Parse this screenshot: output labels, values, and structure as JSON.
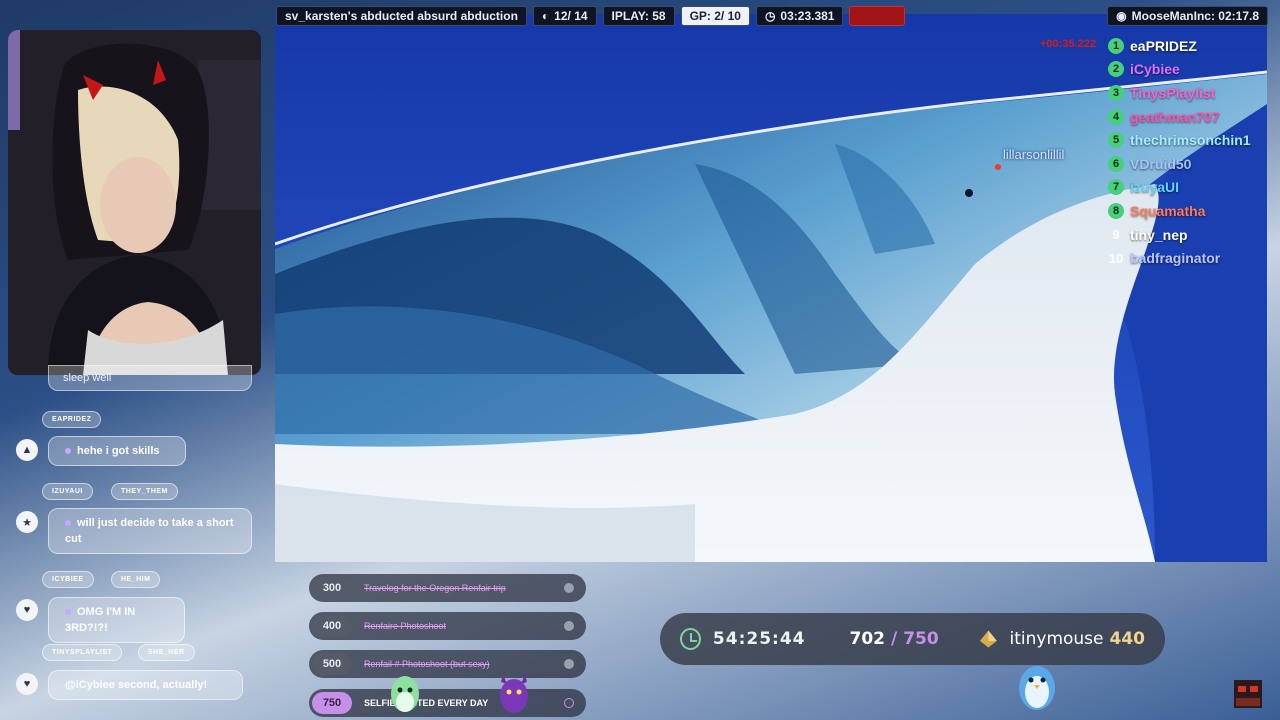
{
  "hud": {
    "title": "sv_karsten's abducted absurd abduction",
    "checkpoints": "12/ 14",
    "play": "IPLAY: 58",
    "gp": "GP: 2/ 10",
    "timer": "03:23.381",
    "status": "",
    "user_time": "MooseManInc: 02:17.8"
  },
  "game": {
    "player_tag": "lillarsonlillil"
  },
  "leaderboard": {
    "time": "+00:35.222",
    "entries": [
      {
        "rank": "1",
        "name": "eaPRIDEZ",
        "color": "#ffffff",
        "badge": true
      },
      {
        "rank": "2",
        "name": "iCybiee",
        "color": "#e070ff",
        "badge": true
      },
      {
        "rank": "3",
        "name": "TinysPlaylist",
        "color": "#ff5cd6",
        "badge": true
      },
      {
        "rank": "4",
        "name": "geathman707",
        "color": "#ff4fb0",
        "badge": true
      },
      {
        "rank": "5",
        "name": "thechrimsonchin1",
        "color": "#a4ecff",
        "badge": true
      },
      {
        "rank": "6",
        "name": "VDruid50",
        "color": "#a4c4ff",
        "badge": true
      },
      {
        "rank": "7",
        "name": "izuyaUI",
        "color": "#5ed6ff",
        "badge": true
      },
      {
        "rank": "8",
        "name": "Squamatha",
        "color": "#ff7a5c",
        "badge": true
      },
      {
        "rank": "9",
        "name": "tiny_nep",
        "color": "#ffffff",
        "badge": false
      },
      {
        "rank": "10",
        "name": "badfraginator",
        "color": "#b8c6ff",
        "badge": false
      }
    ]
  },
  "chat": {
    "partial_message": "sleep well",
    "messages": [
      {
        "user": "EAPRIDEZ",
        "pronoun": "",
        "text": "hehe i got skills",
        "icon": "triangle-icon"
      },
      {
        "user": "IZUYAUI",
        "pronoun": "THEY_THEM",
        "text": "will just decide to take a short cut",
        "icon": "star-icon"
      },
      {
        "user": "ICYBIEE",
        "pronoun": "HE_HIM",
        "text": "OMG I'M IN 3RD?!?!",
        "icon": "heart-icon"
      },
      {
        "user": "TINYSPLAYLIST",
        "pronoun": "SHE_HER",
        "text": "@iCybiee second, actually!",
        "icon": "heart-icon"
      }
    ]
  },
  "goals": [
    {
      "value": "300",
      "text": "Travelog for the Oregon Renfair trip",
      "active": false
    },
    {
      "value": "400",
      "text": "Renfaire Photoshoot",
      "active": false
    },
    {
      "value": "500",
      "text": "Renfail # Photoshoot (but sexy)",
      "active": false
    },
    {
      "value": "750",
      "text": "SELFIE POSTED EVERY DAY",
      "active": true
    }
  ],
  "stats": {
    "elapsed": "54:25:44",
    "count": "702",
    "slash": "/",
    "total": "750",
    "top_user": "itinymouse",
    "top_score": "440"
  },
  "colors": {
    "accent_green": "#45d07c",
    "accent_purple": "#c590e6",
    "danger_red": "#d41c1c"
  }
}
